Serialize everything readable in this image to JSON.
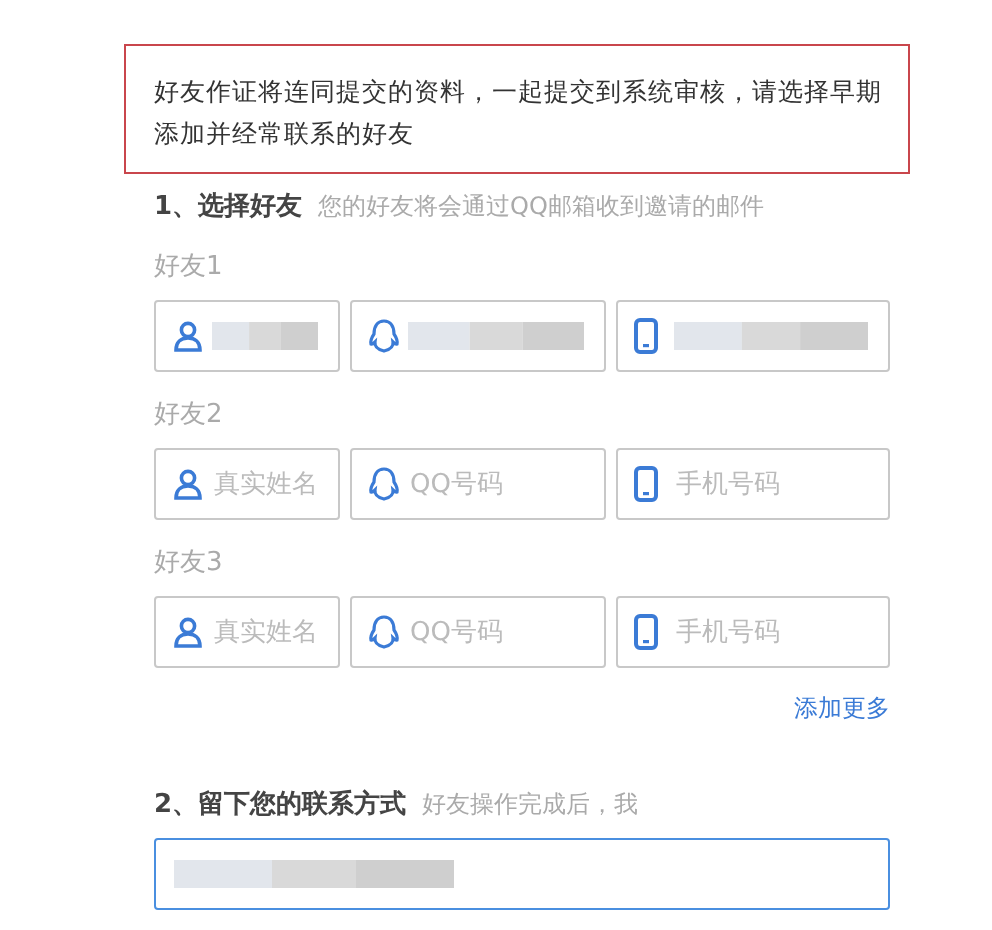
{
  "notice": "好友作证将连同提交的资料，一起提交到系统审核，请选择早期添加并经常联系的好友",
  "section_1": {
    "title": "1、选择好友",
    "hint": "您的好友将会通过QQ邮箱收到邀请的邮件"
  },
  "friends": [
    {
      "label": "好友1",
      "fields": [
        {
          "kind": "name",
          "redacted": true
        },
        {
          "kind": "qq",
          "redacted": true
        },
        {
          "kind": "phone",
          "redacted": true
        }
      ]
    },
    {
      "label": "好友2",
      "fields": [
        {
          "kind": "name",
          "placeholder": "真实姓名",
          "redacted": false
        },
        {
          "kind": "qq",
          "placeholder": "QQ号码",
          "redacted": false
        },
        {
          "kind": "phone",
          "placeholder": "手机号码",
          "redacted": false
        }
      ]
    },
    {
      "label": "好友3",
      "fields": [
        {
          "kind": "name",
          "placeholder": "真实姓名",
          "redacted": false
        },
        {
          "kind": "qq",
          "placeholder": "QQ号码",
          "redacted": false
        },
        {
          "kind": "phone",
          "placeholder": "手机号码",
          "redacted": false
        }
      ]
    }
  ],
  "add_more": "添加更多",
  "section_2": {
    "title": "2、留下您的联系方式",
    "hint": "好友操作完成后，我",
    "contact_field": {
      "redacted": true,
      "focused": true
    }
  }
}
